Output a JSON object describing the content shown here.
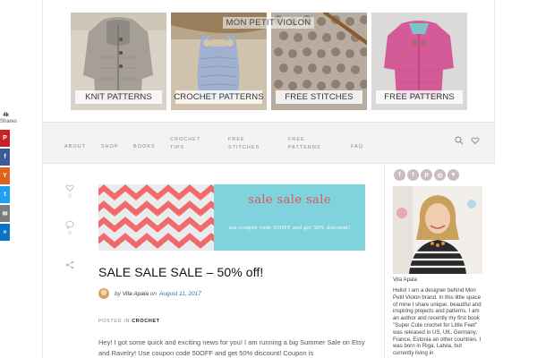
{
  "site": {
    "title": "MON PETIT VIOLON",
    "tiles": [
      {
        "label": "KNIT PATTERNS"
      },
      {
        "label": "CROCHET PATTERNS"
      },
      {
        "label": "FREE STITCHES"
      },
      {
        "label": "FREE PATTERNS"
      }
    ]
  },
  "share": {
    "count": "4k",
    "count_label": "Shares",
    "buttons": [
      {
        "icon": "pinterest-icon",
        "glyph": "P",
        "color": "#cb2027"
      },
      {
        "icon": "facebook-icon",
        "glyph": "f",
        "color": "#3b5998"
      },
      {
        "icon": "yummly-icon",
        "glyph": "Y",
        "color": "#e16120"
      },
      {
        "icon": "twitter-icon",
        "glyph": "t",
        "color": "#1da1f2"
      },
      {
        "icon": "email-icon",
        "glyph": "✉",
        "color": "#7d7d7d"
      },
      {
        "icon": "sumome-icon",
        "glyph": "»",
        "color": "#0b71c9"
      }
    ]
  },
  "nav": {
    "items": [
      {
        "label": "ABOUT"
      },
      {
        "label": "SHOP"
      },
      {
        "label": "BOOKS"
      },
      {
        "label": "CROCHET\nTIPS"
      },
      {
        "label": "FREE\nSTITCHES"
      },
      {
        "label": "FREE\nPATTERNS"
      },
      {
        "label": "FAQ"
      }
    ]
  },
  "post": {
    "like_count": "0",
    "comment_count": "0",
    "banner_headline": "sale sale sale",
    "banner_sub": "use coupon code 50OFF and get 50% discount!",
    "title": "SALE SALE SALE – 50% off!",
    "byline_prefix": "by",
    "author": "Vita Apala",
    "date_prefix": "on",
    "date": "August 11, 2017",
    "posted_in_label": "POSTED IN",
    "category": "CROCHET",
    "excerpt": "Hey! I got some quick and exciting news for you! I am running a big Summer Sale on Etsy and Ravelry! Use coupon code 50OFF and get 50% discount! Coupon is"
  },
  "sidebar": {
    "bio_name": "Vita Apala",
    "bio_text": "Hello! I am a designer behind Mon Petit Violon brand. In this little space of mine I share unique, beautiful and inspiring projects and patterns. I am an author and recently my first book \"Super Cute crochet for Little Feet\" was released in US, UK, Germany, France, Estonia an other countries. I was born in Riga, Latvia, but currently living in"
  },
  "colors": {
    "accent_red": "#e8505b",
    "banner_teal": "#7fd3dc"
  }
}
